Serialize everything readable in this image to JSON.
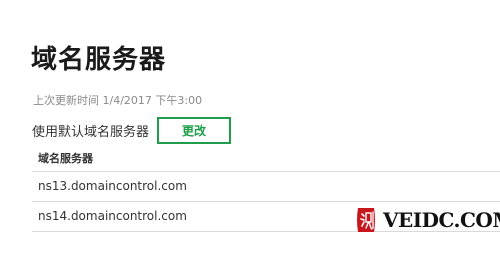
{
  "page": {
    "title": "域名服务器",
    "last_updated": "上次更新时间 1/4/2017 下午3:00"
  },
  "default_servers": {
    "label": "使用默认域名服务器",
    "change_button": "更改"
  },
  "nameservers": {
    "header": "域名服务器",
    "rows": [
      "ns13.domaincontrol.com",
      "ns14.domaincontrol.com"
    ]
  },
  "watermark": {
    "seal_char": "测",
    "text": "VEIDC.COM"
  },
  "colors": {
    "accent": "#1f9d4a",
    "seal": "#c8161d"
  }
}
